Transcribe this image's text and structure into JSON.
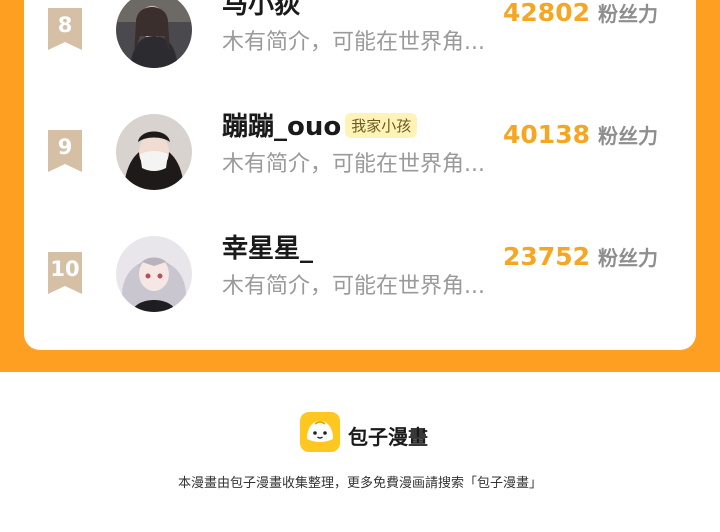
{
  "colors": {
    "accent": "#FF9F22",
    "count": "#F5A623",
    "rank_ribbon": "#D5BFA5",
    "badge_bg": "#FFF3B8",
    "logo_bg": "#FFC71F"
  },
  "ranking": {
    "fans_label": "粉丝力",
    "items": [
      {
        "rank": "8",
        "name": "马小荻",
        "badge": "",
        "bio": "木有简介，可能在世界角...",
        "fans": "42802"
      },
      {
        "rank": "9",
        "name": "蹦蹦_ouo",
        "badge": "我家小孩",
        "bio": "木有简介，可能在世界角...",
        "fans": "40138"
      },
      {
        "rank": "10",
        "name": "幸星星_",
        "badge": "",
        "bio": "木有简介，可能在世界角...",
        "fans": "23752"
      }
    ]
  },
  "footer": {
    "logo_icon": "bun-face-icon",
    "brand": "包子漫畫",
    "note": "本漫畫由包子漫畫收集整理，更多免費漫画請搜索「包子漫畫」"
  }
}
